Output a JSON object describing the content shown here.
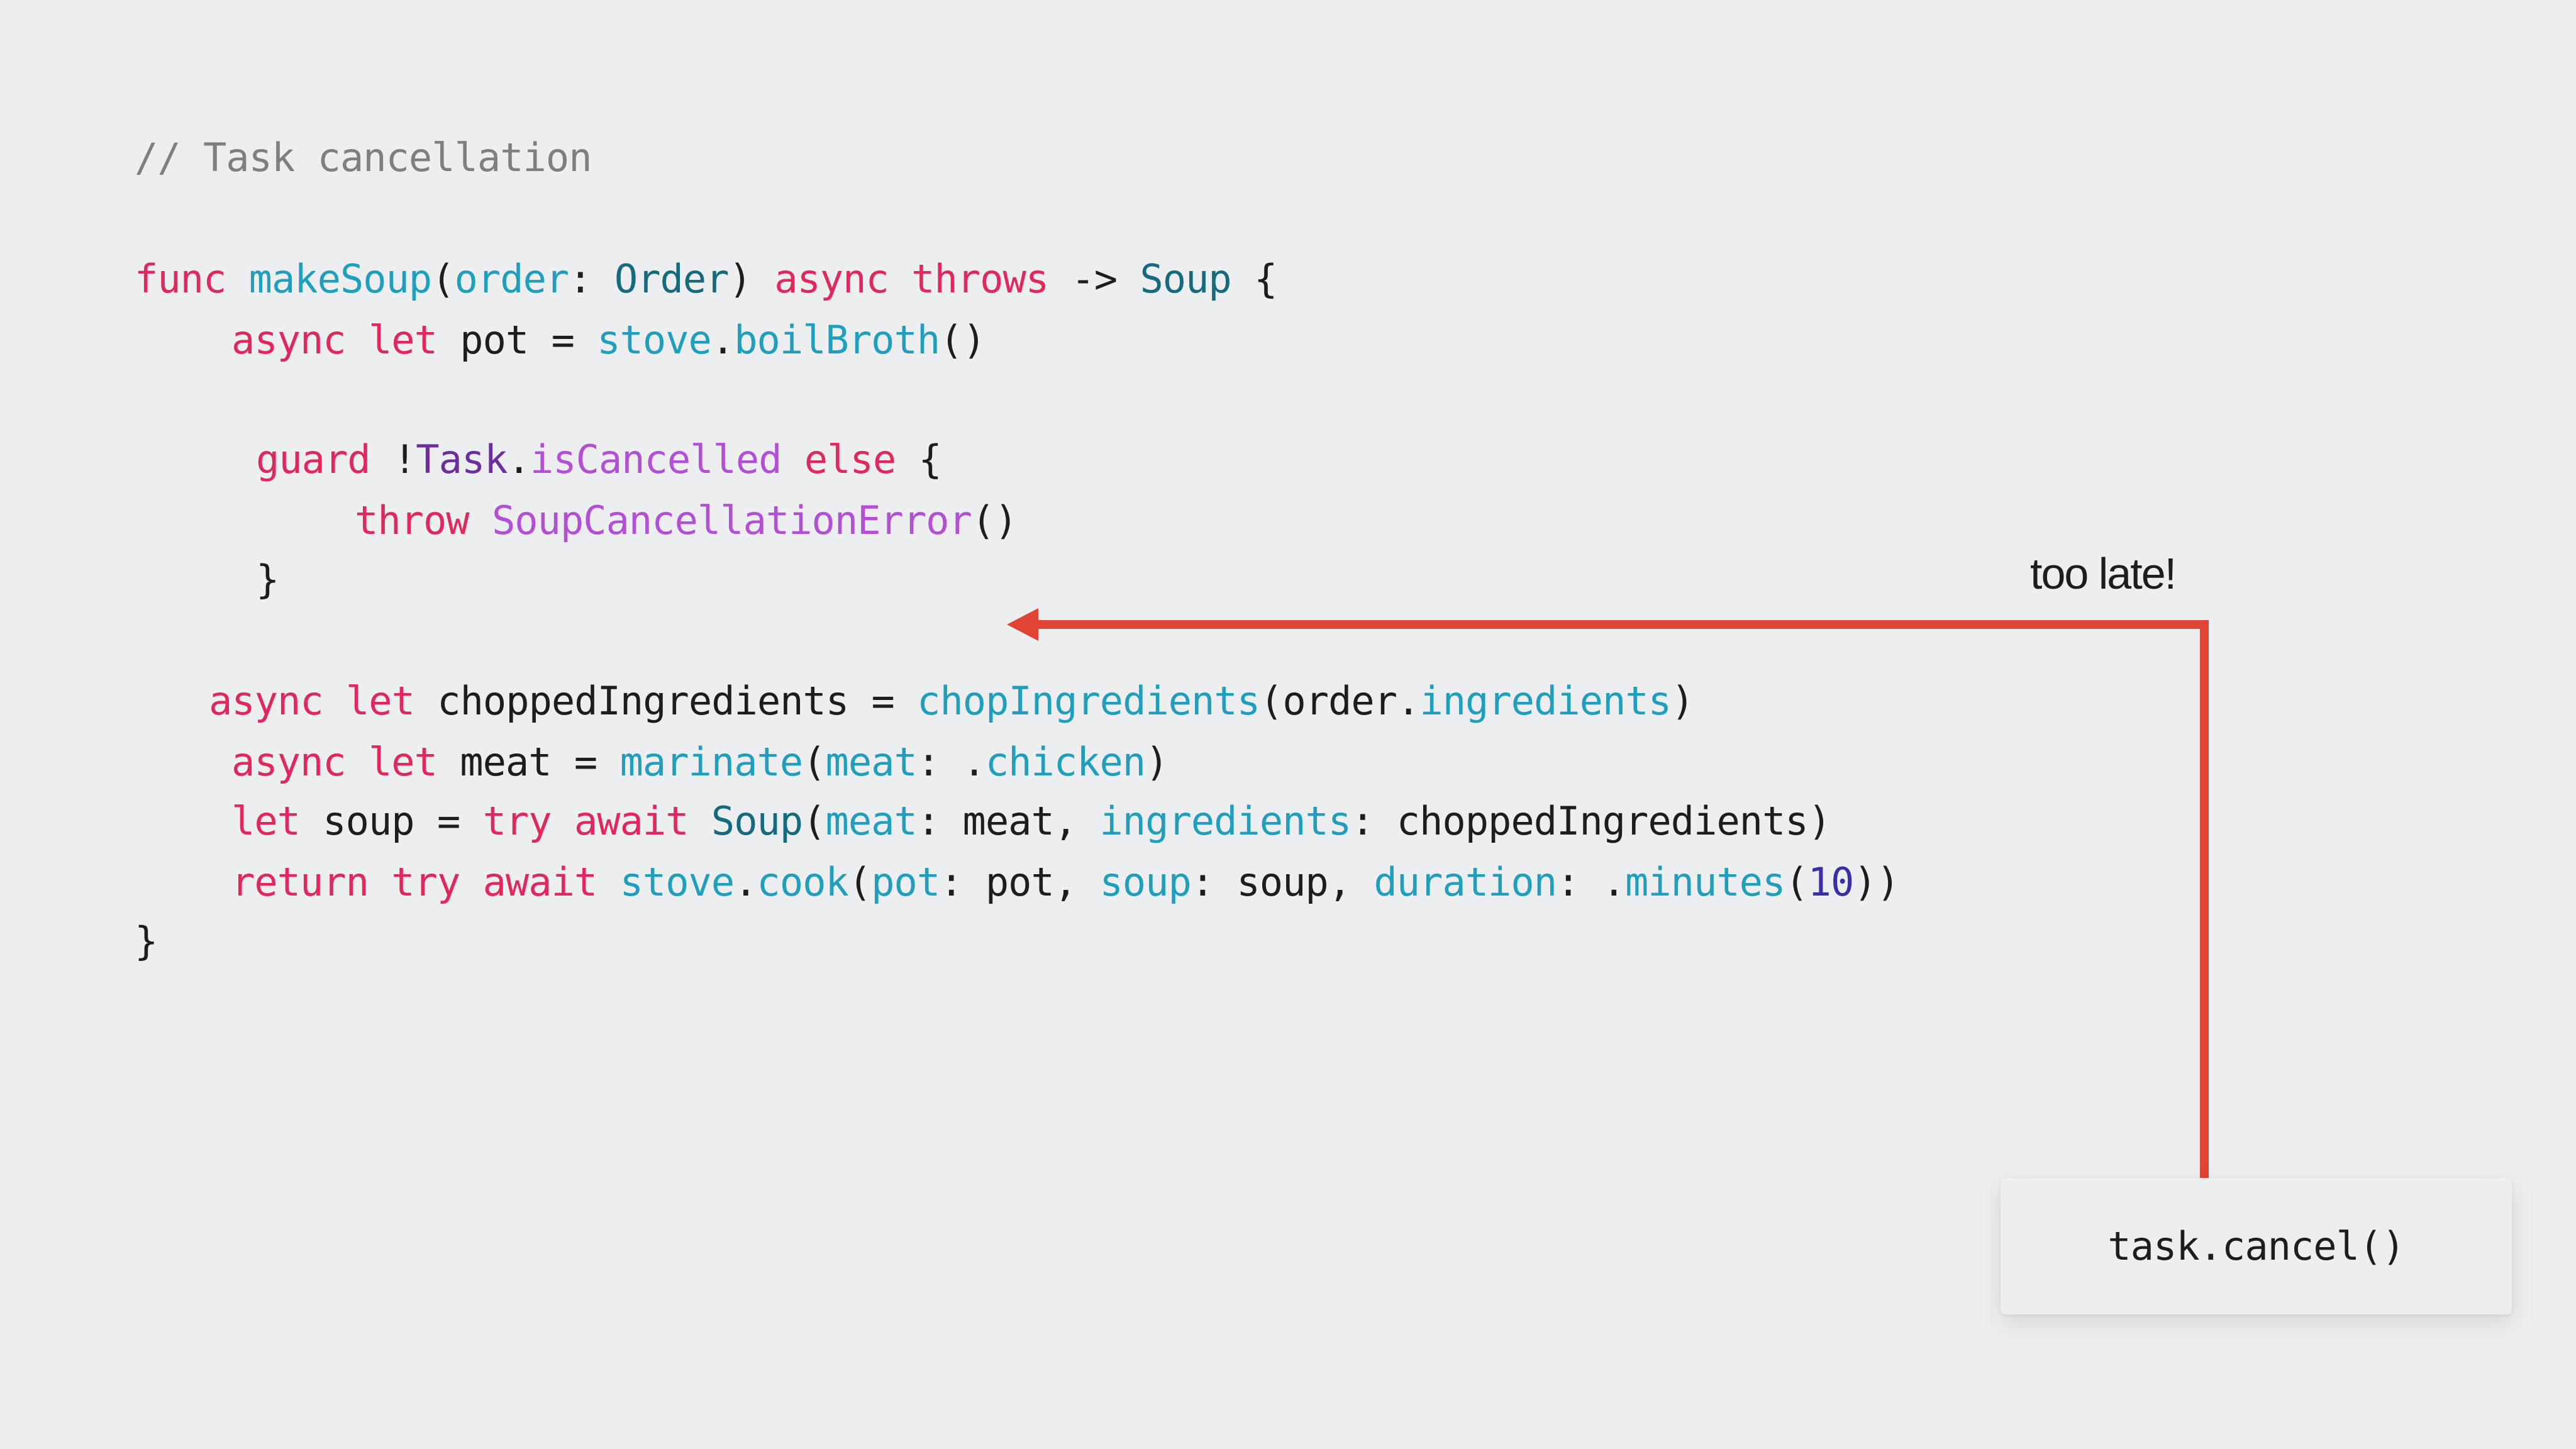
{
  "code": {
    "comment": "// Task cancellation",
    "lines": [
      {
        "id": "func-signature",
        "tokens": [
          {
            "t": "func",
            "k": "keyword"
          },
          {
            "t": " ",
            "k": "plain"
          },
          {
            "t": "makeSoup",
            "k": "func"
          },
          {
            "t": "(",
            "k": "plain"
          },
          {
            "t": "order",
            "k": "param"
          },
          {
            "t": ": ",
            "k": "plain"
          },
          {
            "t": "Order",
            "k": "type"
          },
          {
            "t": ") ",
            "k": "plain"
          },
          {
            "t": "async",
            "k": "keyword"
          },
          {
            "t": " ",
            "k": "plain"
          },
          {
            "t": "throws",
            "k": "keyword"
          },
          {
            "t": " -> ",
            "k": "plain"
          },
          {
            "t": "Soup",
            "k": "type"
          },
          {
            "t": " {",
            "k": "plain"
          }
        ]
      },
      {
        "id": "async-let-pot",
        "tokens": [
          {
            "t": "async",
            "k": "keyword"
          },
          {
            "t": " ",
            "k": "plain"
          },
          {
            "t": "let",
            "k": "keyword"
          },
          {
            "t": " pot = ",
            "k": "plain"
          },
          {
            "t": "stove",
            "k": "func"
          },
          {
            "t": ".",
            "k": "plain"
          },
          {
            "t": "boilBroth",
            "k": "func"
          },
          {
            "t": "()",
            "k": "plain"
          }
        ]
      },
      {
        "id": "guard-cancelled",
        "tokens": [
          {
            "t": "guard",
            "k": "keyword"
          },
          {
            "t": " !",
            "k": "plain"
          },
          {
            "t": "Task",
            "k": "typepurple"
          },
          {
            "t": ".",
            "k": "plain"
          },
          {
            "t": "isCancelled",
            "k": "purple"
          },
          {
            "t": " ",
            "k": "plain"
          },
          {
            "t": "else",
            "k": "keyword"
          },
          {
            "t": " {",
            "k": "plain"
          }
        ]
      },
      {
        "id": "throw-error",
        "tokens": [
          {
            "t": "throw",
            "k": "keyword"
          },
          {
            "t": " ",
            "k": "plain"
          },
          {
            "t": "SoupCancellationError",
            "k": "purple"
          },
          {
            "t": "()",
            "k": "plain"
          }
        ]
      },
      {
        "id": "guard-close",
        "tokens": [
          {
            "t": "}",
            "k": "plain"
          }
        ]
      },
      {
        "id": "async-let-chopped",
        "tokens": [
          {
            "t": "async",
            "k": "keyword"
          },
          {
            "t": " ",
            "k": "plain"
          },
          {
            "t": "let",
            "k": "keyword"
          },
          {
            "t": " choppedIngredients = ",
            "k": "plain"
          },
          {
            "t": "chopIngredients",
            "k": "func"
          },
          {
            "t": "(order.",
            "k": "plain"
          },
          {
            "t": "ingredients",
            "k": "func"
          },
          {
            "t": ")",
            "k": "plain"
          }
        ]
      },
      {
        "id": "async-let-meat",
        "tokens": [
          {
            "t": "async",
            "k": "keyword"
          },
          {
            "t": " ",
            "k": "plain"
          },
          {
            "t": "let",
            "k": "keyword"
          },
          {
            "t": " meat = ",
            "k": "plain"
          },
          {
            "t": "marinate",
            "k": "func"
          },
          {
            "t": "(",
            "k": "plain"
          },
          {
            "t": "meat",
            "k": "param"
          },
          {
            "t": ": .",
            "k": "plain"
          },
          {
            "t": "chicken",
            "k": "func"
          },
          {
            "t": ")",
            "k": "plain"
          }
        ]
      },
      {
        "id": "let-soup",
        "tokens": [
          {
            "t": "let",
            "k": "keyword"
          },
          {
            "t": " soup = ",
            "k": "plain"
          },
          {
            "t": "try",
            "k": "keyword"
          },
          {
            "t": " ",
            "k": "plain"
          },
          {
            "t": "await",
            "k": "keyword"
          },
          {
            "t": " ",
            "k": "plain"
          },
          {
            "t": "Soup",
            "k": "type"
          },
          {
            "t": "(",
            "k": "plain"
          },
          {
            "t": "meat",
            "k": "param"
          },
          {
            "t": ": meat, ",
            "k": "plain"
          },
          {
            "t": "ingredients",
            "k": "param"
          },
          {
            "t": ": choppedIngredients)",
            "k": "plain"
          }
        ]
      },
      {
        "id": "return-cook",
        "tokens": [
          {
            "t": "return",
            "k": "keyword"
          },
          {
            "t": " ",
            "k": "plain"
          },
          {
            "t": "try",
            "k": "keyword"
          },
          {
            "t": " ",
            "k": "plain"
          },
          {
            "t": "await",
            "k": "keyword"
          },
          {
            "t": " ",
            "k": "plain"
          },
          {
            "t": "stove",
            "k": "func"
          },
          {
            "t": ".",
            "k": "plain"
          },
          {
            "t": "cook",
            "k": "func"
          },
          {
            "t": "(",
            "k": "plain"
          },
          {
            "t": "pot",
            "k": "param"
          },
          {
            "t": ": pot, ",
            "k": "plain"
          },
          {
            "t": "soup",
            "k": "param"
          },
          {
            "t": ": soup, ",
            "k": "plain"
          },
          {
            "t": "duration",
            "k": "param"
          },
          {
            "t": ": .",
            "k": "plain"
          },
          {
            "t": "minutes",
            "k": "func"
          },
          {
            "t": "(",
            "k": "plain"
          },
          {
            "t": "10",
            "k": "number"
          },
          {
            "t": "))",
            "k": "plain"
          }
        ]
      },
      {
        "id": "func-close",
        "tokens": [
          {
            "t": "}",
            "k": "plain"
          }
        ]
      }
    ]
  },
  "annotation": {
    "label": "too late!",
    "arrow_color": "#e04434"
  },
  "cancel_box": {
    "code": "task.cancel()"
  }
}
